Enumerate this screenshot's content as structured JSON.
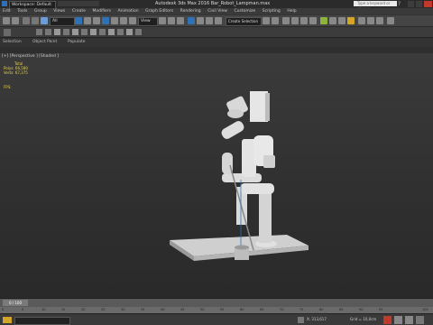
{
  "titlebar": {
    "workspace": "Workspace: Default",
    "title": "Autodesk 3ds Max 2016    Bar_Robot_Lampman.max",
    "search_placeholder": "Type a keyword or phrase"
  },
  "menu": [
    "Edit",
    "Tools",
    "Group",
    "Views",
    "Create",
    "Modifiers",
    "Animation",
    "Graph Editors",
    "Rendering",
    "Civil View",
    "Customize",
    "Scripting",
    "Help"
  ],
  "toolbar": {
    "filter": "All",
    "view": "View",
    "named_set": "Create Selection Se"
  },
  "ribbon2": {
    "tabs": [
      "Selection",
      "Object Paint",
      "Populate"
    ]
  },
  "viewport": {
    "label": "[+] [Perspective ] [Shaded ]",
    "stats": {
      "header": "Total",
      "polys_label": "Polys:",
      "polys_value": "66,580",
      "verts_label": "Verts:",
      "verts_value": "67,375"
    },
    "fps_label": "FPS:"
  },
  "timeline": {
    "frame": "0 / 100"
  },
  "ticks": [
    "0",
    "5",
    "10",
    "15",
    "20",
    "25",
    "30",
    "35",
    "40",
    "45",
    "50",
    "55",
    "60",
    "65",
    "70",
    "75",
    "80",
    "85",
    "90",
    "95",
    "100"
  ],
  "statusbar": {
    "coord_x": "X: 313,617",
    "grid": "Grid = 10,0cm"
  },
  "colors": {
    "accent": "#2e72b5",
    "stats": "#e8d44d"
  }
}
